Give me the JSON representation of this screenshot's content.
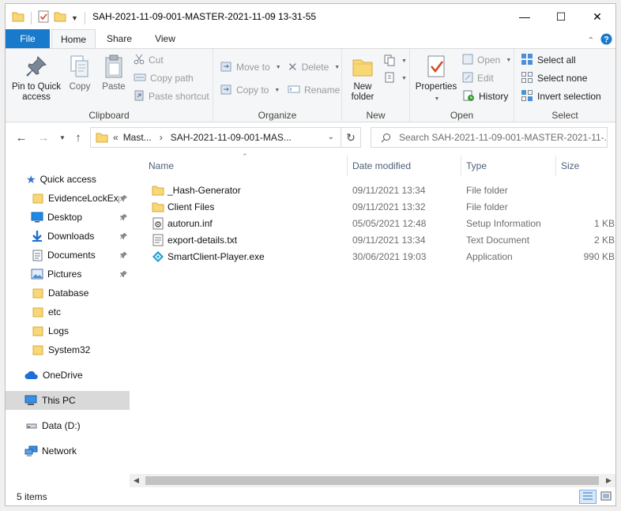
{
  "window": {
    "title": "SAH-2021-11-09-001-MASTER-2021-11-09 13-31-55",
    "controls": {
      "minimize": "—",
      "maximize": "☐",
      "close": "✕"
    }
  },
  "tabs": [
    {
      "label": "File"
    },
    {
      "label": "Home"
    },
    {
      "label": "Share"
    },
    {
      "label": "View"
    }
  ],
  "ribbon": {
    "clipboard": {
      "label": "Clipboard",
      "pin_line1": "Pin to Quick",
      "pin_line2": "access",
      "copy": "Copy",
      "paste": "Paste",
      "cut": "Cut",
      "copy_path": "Copy path",
      "paste_shortcut": "Paste shortcut"
    },
    "organize": {
      "label": "Organize",
      "move_to": "Move to",
      "copy_to": "Copy to",
      "delete": "Delete",
      "rename": "Rename"
    },
    "new": {
      "label": "New",
      "new_folder_line1": "New",
      "new_folder_line2": "folder"
    },
    "open": {
      "label": "Open",
      "properties": "Properties",
      "open": "Open",
      "edit": "Edit",
      "history": "History"
    },
    "select": {
      "label": "Select",
      "select_all": "Select all",
      "select_none": "Select none",
      "invert": "Invert selection"
    }
  },
  "address": {
    "chevrons": "«",
    "seg1": "Mast...",
    "seg2": "SAH-2021-11-09-001-MAS...",
    "search_placeholder": "Search SAH-2021-11-09-001-MASTER-2021-11-..."
  },
  "nav": {
    "quick_access": "Quick access",
    "items": [
      {
        "label": "EvidenceLockExp"
      },
      {
        "label": "Desktop"
      },
      {
        "label": "Downloads"
      },
      {
        "label": "Documents"
      },
      {
        "label": "Pictures"
      },
      {
        "label": "Database"
      },
      {
        "label": "etc"
      },
      {
        "label": "Logs"
      },
      {
        "label": "System32"
      }
    ],
    "onedrive": "OneDrive",
    "this_pc": "This PC",
    "data_drive": "Data (D:)",
    "network": "Network"
  },
  "columns": {
    "name": "Name",
    "date": "Date modified",
    "type": "Type",
    "size": "Size"
  },
  "files": [
    {
      "name": "_Hash-Generator",
      "date": "09/11/2021 13:34",
      "type": "File folder",
      "size": "",
      "icon": "folder-icon"
    },
    {
      "name": "Client Files",
      "date": "09/11/2021 13:32",
      "type": "File folder",
      "size": "",
      "icon": "folder-icon"
    },
    {
      "name": "autorun.inf",
      "date": "05/05/2021 12:48",
      "type": "Setup Information",
      "size": "1 KB",
      "icon": "settings-file-icon"
    },
    {
      "name": "export-details.txt",
      "date": "09/11/2021 13:34",
      "type": "Text Document",
      "size": "2 KB",
      "icon": "text-file-icon"
    },
    {
      "name": "SmartClient-Player.exe",
      "date": "30/06/2021 19:03",
      "type": "Application",
      "size": "990 KB",
      "icon": "app-icon"
    }
  ],
  "status": {
    "item_count": "5 items"
  },
  "colors": {
    "file_tab": "#1979ca",
    "folder": "#f8d775",
    "folder_dark": "#e3b94d",
    "selection": "#d9d9d9"
  }
}
